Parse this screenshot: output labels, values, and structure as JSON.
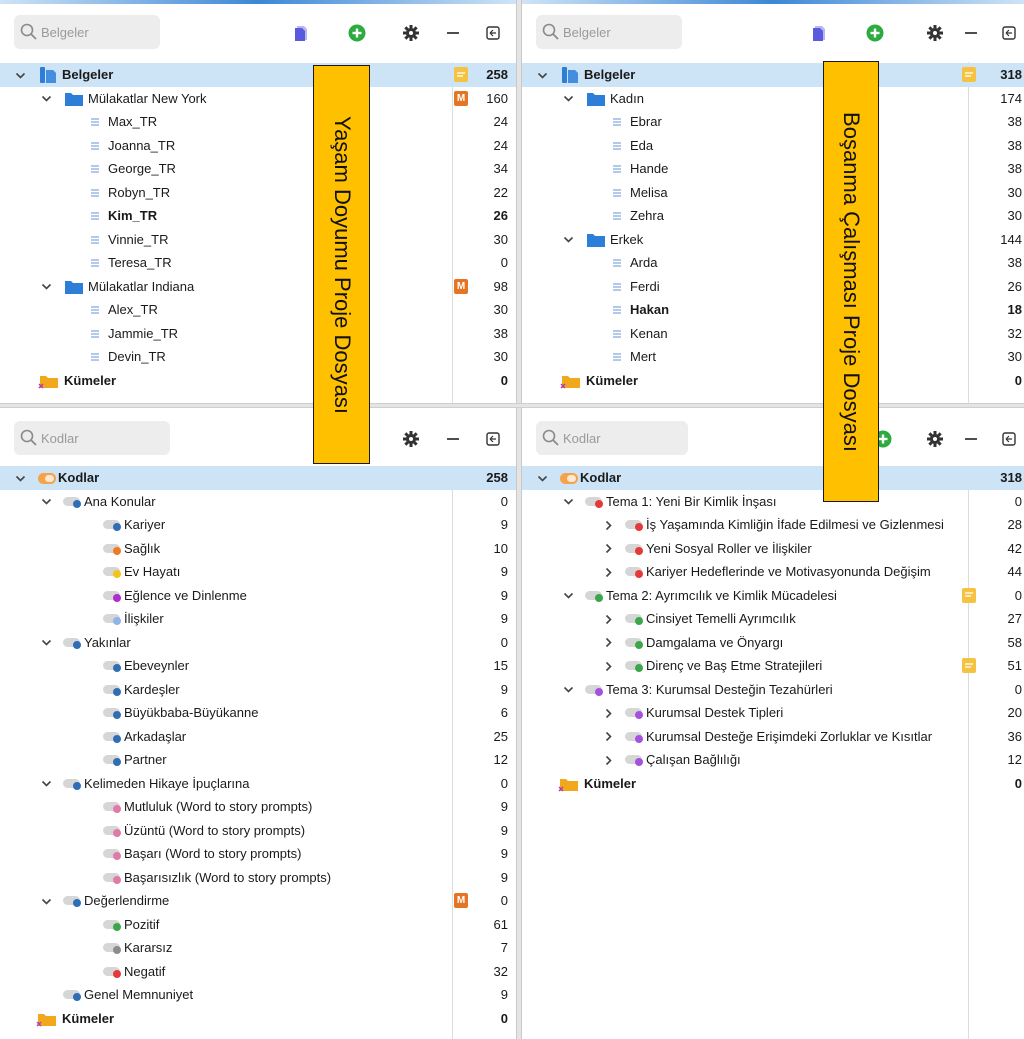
{
  "colors": {
    "accent": "#3c87d6",
    "selection": "#cde4f7",
    "callout": "#ffc000",
    "memo_badge": "#e57524",
    "note_badge": "#f5c242",
    "folder": "#2d7ed8",
    "add_button": "#2eab3f"
  },
  "icons": {
    "search": "search-icon",
    "new_document": "new-document-icon",
    "add": "plus-circle-icon",
    "settings": "gear-icon",
    "minimize": "minimize-icon",
    "restore": "restore-window-icon",
    "folder": "folder-icon",
    "document": "document-icon",
    "code": "code-icon",
    "set": "set-icon"
  },
  "left_docs": {
    "search_placeholder": "Belgeler",
    "rows": [
      {
        "label": "Belgeler",
        "count": "258",
        "level": 0,
        "icon": "root",
        "expanded": true,
        "bold": true,
        "selected": true,
        "badge": "note"
      },
      {
        "label": "Mülakatlar New York",
        "count": "160",
        "level": 1,
        "icon": "folder",
        "expanded": true,
        "badge": "memo",
        "badge_text": "M"
      },
      {
        "label": "Max_TR",
        "count": "24",
        "level": 2,
        "icon": "doc"
      },
      {
        "label": "Joanna_TR",
        "count": "24",
        "level": 2,
        "icon": "doc"
      },
      {
        "label": "George_TR",
        "count": "34",
        "level": 2,
        "icon": "doc"
      },
      {
        "label": "Robyn_TR",
        "count": "22",
        "level": 2,
        "icon": "doc"
      },
      {
        "label": "Kim_TR",
        "count": "26",
        "level": 2,
        "icon": "doc",
        "bold": true
      },
      {
        "label": "Vinnie_TR",
        "count": "30",
        "level": 2,
        "icon": "doc"
      },
      {
        "label": "Teresa_TR",
        "count": "0",
        "level": 2,
        "icon": "doc"
      },
      {
        "label": "Mülakatlar Indiana",
        "count": "98",
        "level": 1,
        "icon": "folder",
        "expanded": true,
        "badge": "memo",
        "badge_text": "M"
      },
      {
        "label": "Alex_TR",
        "count": "30",
        "level": 2,
        "icon": "doc"
      },
      {
        "label": "Jammie_TR",
        "count": "38",
        "level": 2,
        "icon": "doc"
      },
      {
        "label": "Devin_TR",
        "count": "30",
        "level": 2,
        "icon": "doc"
      },
      {
        "label": "Kümeler",
        "count": "0",
        "level": 0,
        "icon": "set",
        "bold": true
      }
    ]
  },
  "right_docs": {
    "search_placeholder": "Belgeler",
    "rows": [
      {
        "label": "Belgeler",
        "count": "318",
        "level": 0,
        "icon": "root",
        "expanded": true,
        "bold": true,
        "selected": true,
        "badge": "note"
      },
      {
        "label": "Kadın",
        "count": "174",
        "level": 1,
        "icon": "folder",
        "expanded": true
      },
      {
        "label": "Ebrar",
        "count": "38",
        "level": 2,
        "icon": "doc"
      },
      {
        "label": "Eda",
        "count": "38",
        "level": 2,
        "icon": "doc"
      },
      {
        "label": "Hande",
        "count": "38",
        "level": 2,
        "icon": "doc"
      },
      {
        "label": "Melisa",
        "count": "30",
        "level": 2,
        "icon": "doc"
      },
      {
        "label": "Zehra",
        "count": "30",
        "level": 2,
        "icon": "doc"
      },
      {
        "label": "Erkek",
        "count": "144",
        "level": 1,
        "icon": "folder",
        "expanded": true
      },
      {
        "label": "Arda",
        "count": "38",
        "level": 2,
        "icon": "doc"
      },
      {
        "label": "Ferdi",
        "count": "26",
        "level": 2,
        "icon": "doc"
      },
      {
        "label": "Hakan",
        "count": "18",
        "level": 2,
        "icon": "doc",
        "bold": true
      },
      {
        "label": "Kenan",
        "count": "32",
        "level": 2,
        "icon": "doc"
      },
      {
        "label": "Mert",
        "count": "30",
        "level": 2,
        "icon": "doc"
      },
      {
        "label": "Kümeler",
        "count": "0",
        "level": 0,
        "icon": "set",
        "bold": true
      }
    ]
  },
  "left_codes": {
    "search_placeholder": "Kodlar",
    "rows": [
      {
        "label": "Kodlar",
        "count": "258",
        "level": 0,
        "icon": "coderoot",
        "expanded": true,
        "bold": true,
        "selected": true
      },
      {
        "label": "Ana Konular",
        "count": "0",
        "level": 1,
        "icon": "code",
        "color": "#2f6db5",
        "expanded": true
      },
      {
        "label": "Kariyer",
        "count": "9",
        "level": 2,
        "icon": "code",
        "color": "#2f6db5"
      },
      {
        "label": "Sağlık",
        "count": "10",
        "level": 2,
        "icon": "code",
        "color": "#f07a22"
      },
      {
        "label": "Ev Hayatı",
        "count": "9",
        "level": 2,
        "icon": "code",
        "color": "#f3c419"
      },
      {
        "label": "Eğlence ve Dinlenme",
        "count": "9",
        "level": 2,
        "icon": "code",
        "color": "#b02bd0"
      },
      {
        "label": "İlişkiler",
        "count": "9",
        "level": 2,
        "icon": "code",
        "color": "#8fb5e8"
      },
      {
        "label": "Yakınlar",
        "count": "0",
        "level": 1,
        "icon": "code",
        "color": "#2f6db5",
        "expanded": true
      },
      {
        "label": "Ebeveynler",
        "count": "15",
        "level": 2,
        "icon": "code",
        "color": "#2f6db5"
      },
      {
        "label": "Kardeşler",
        "count": "9",
        "level": 2,
        "icon": "code",
        "color": "#2f6db5"
      },
      {
        "label": "Büyükbaba-Büyükanne",
        "count": "6",
        "level": 2,
        "icon": "code",
        "color": "#2f6db5"
      },
      {
        "label": "Arkadaşlar",
        "count": "25",
        "level": 2,
        "icon": "code",
        "color": "#2f6db5"
      },
      {
        "label": "Partner",
        "count": "12",
        "level": 2,
        "icon": "code",
        "color": "#2f6db5"
      },
      {
        "label": "Kelimeden Hikaye İpuçlarına",
        "count": "0",
        "level": 1,
        "icon": "code",
        "color": "#2f6db5",
        "expanded": true
      },
      {
        "label": "Mutluluk (Word to story prompts)",
        "count": "9",
        "level": 2,
        "icon": "code",
        "color": "#e07aa8"
      },
      {
        "label": "Üzüntü (Word to story prompts)",
        "count": "9",
        "level": 2,
        "icon": "code",
        "color": "#e07aa8"
      },
      {
        "label": "Başarı (Word to story prompts)",
        "count": "9",
        "level": 2,
        "icon": "code",
        "color": "#e07aa8"
      },
      {
        "label": "Başarısızlık (Word to story prompts)",
        "count": "9",
        "level": 2,
        "icon": "code",
        "color": "#e07aa8"
      },
      {
        "label": "Değerlendirme",
        "count": "0",
        "level": 1,
        "icon": "code",
        "color": "#2f6db5",
        "expanded": true,
        "badge": "memo",
        "badge_text": "M"
      },
      {
        "label": "Pozitif",
        "count": "61",
        "level": 2,
        "icon": "code",
        "color": "#3aa84a"
      },
      {
        "label": "Kararsız",
        "count": "7",
        "level": 2,
        "icon": "code",
        "color": "#8c8c8c"
      },
      {
        "label": "Negatif",
        "count": "32",
        "level": 2,
        "icon": "code",
        "color": "#e43a3a"
      },
      {
        "label": "Genel Memnuniyet",
        "count": "9",
        "level": 1,
        "icon": "code",
        "color": "#2f6db5"
      },
      {
        "label": "Kümeler",
        "count": "0",
        "level": 0,
        "icon": "set",
        "bold": true
      }
    ]
  },
  "right_codes": {
    "search_placeholder": "Kodlar",
    "rows": [
      {
        "label": "Kodlar",
        "count": "318",
        "level": 0,
        "icon": "coderoot",
        "expanded": true,
        "bold": true,
        "selected": true
      },
      {
        "label": "Tema 1: Yeni Bir Kimlik İnşası",
        "count": "0",
        "level": 1,
        "icon": "code",
        "color": "#e43a3a",
        "expanded": true
      },
      {
        "label": "İş Yaşamında Kimliğin İfade Edilmesi ve Gizlenmesi",
        "count": "28",
        "level": 2,
        "icon": "code",
        "color": "#e43a3a",
        "collapsed": true
      },
      {
        "label": "Yeni Sosyal Roller ve İlişkiler",
        "count": "42",
        "level": 2,
        "icon": "code",
        "color": "#e43a3a",
        "collapsed": true
      },
      {
        "label": "Kariyer Hedeflerinde ve Motivasyonunda Değişim",
        "count": "44",
        "level": 2,
        "icon": "code",
        "color": "#e43a3a",
        "collapsed": true
      },
      {
        "label": "Tema 2: Ayrımcılık ve Kimlik Mücadelesi",
        "count": "0",
        "level": 1,
        "icon": "code",
        "color": "#3aa84a",
        "expanded": true,
        "badge": "note"
      },
      {
        "label": "Cinsiyet Temelli Ayrımcılık",
        "count": "27",
        "level": 2,
        "icon": "code",
        "color": "#3aa84a",
        "collapsed": true
      },
      {
        "label": "Damgalama ve Önyargı",
        "count": "58",
        "level": 2,
        "icon": "code",
        "color": "#3aa84a",
        "collapsed": true
      },
      {
        "label": "Direnç ve Baş Etme Stratejileri",
        "count": "51",
        "level": 2,
        "icon": "code",
        "color": "#3aa84a",
        "collapsed": true,
        "badge": "note"
      },
      {
        "label": "Tema 3: Kurumsal Desteğin Tezahürleri",
        "count": "0",
        "level": 1,
        "icon": "code",
        "color": "#a551e0",
        "expanded": true
      },
      {
        "label": "Kurumsal Destek Tipleri",
        "count": "20",
        "level": 2,
        "icon": "code",
        "color": "#a551e0",
        "collapsed": true
      },
      {
        "label": "Kurumsal Desteğe Erişimdeki Zorluklar ve Kısıtlar",
        "count": "36",
        "level": 2,
        "icon": "code",
        "color": "#a551e0",
        "collapsed": true
      },
      {
        "label": "Çalışan Bağlılığı",
        "count": "12",
        "level": 2,
        "icon": "code",
        "color": "#a551e0",
        "collapsed": true
      },
      {
        "label": "Kümeler",
        "count": "0",
        "level": 0,
        "icon": "set",
        "bold": true
      }
    ]
  },
  "callouts": {
    "left": "Yaşam Doyumu Proje Dosyası",
    "right": "Boşanma Çalışması Proje Dosyası"
  }
}
